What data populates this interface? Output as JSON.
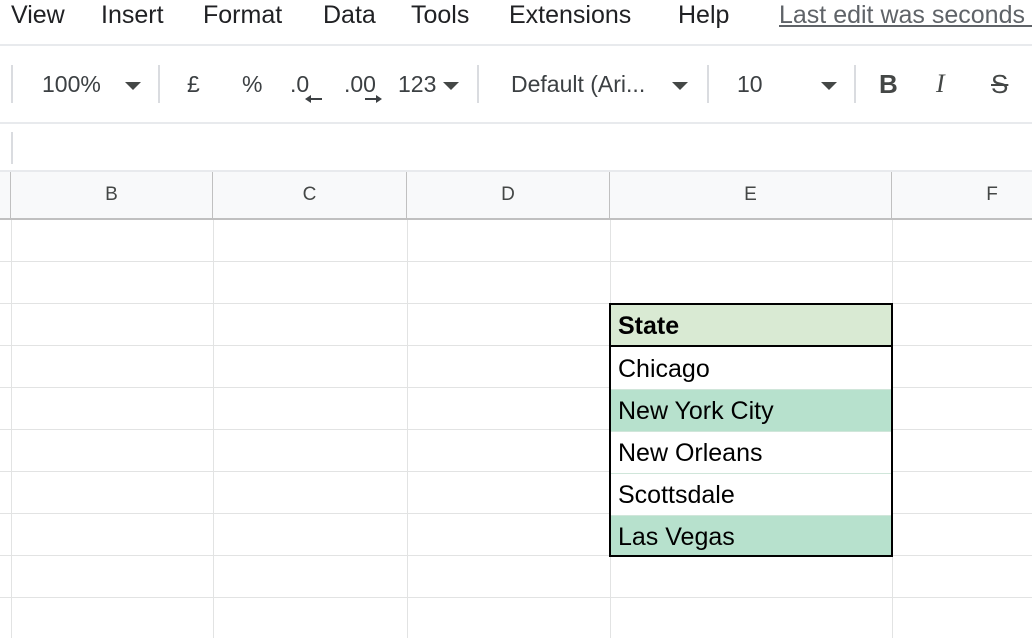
{
  "menu": {
    "items": [
      "View",
      "Insert",
      "Format",
      "Data",
      "Tools",
      "Extensions",
      "Help"
    ],
    "last_edit": "Last edit was seconds ago"
  },
  "toolbar": {
    "zoom": "100%",
    "currency": "£",
    "percent": "%",
    "decrease_decimal": ".0",
    "increase_decimal": ".00",
    "number_format": "123",
    "font": "Default (Ari...",
    "font_size": "10",
    "bold": "B",
    "italic": "I",
    "strikethrough": "S"
  },
  "columns": [
    "B",
    "C",
    "D",
    "E",
    "F"
  ],
  "table": {
    "header": "State",
    "rows": [
      {
        "value": "Chicago",
        "band": "white"
      },
      {
        "value": "New York City",
        "band": "green"
      },
      {
        "value": "New Orleans",
        "band": "white"
      },
      {
        "value": "Scottsdale",
        "band": "white"
      },
      {
        "value": "Las Vegas",
        "band": "green"
      }
    ]
  },
  "colors": {
    "header_fill": "#d9ead3",
    "band_green": "#b7e1cd",
    "band_white": "#ffffff",
    "border": "#000000"
  }
}
